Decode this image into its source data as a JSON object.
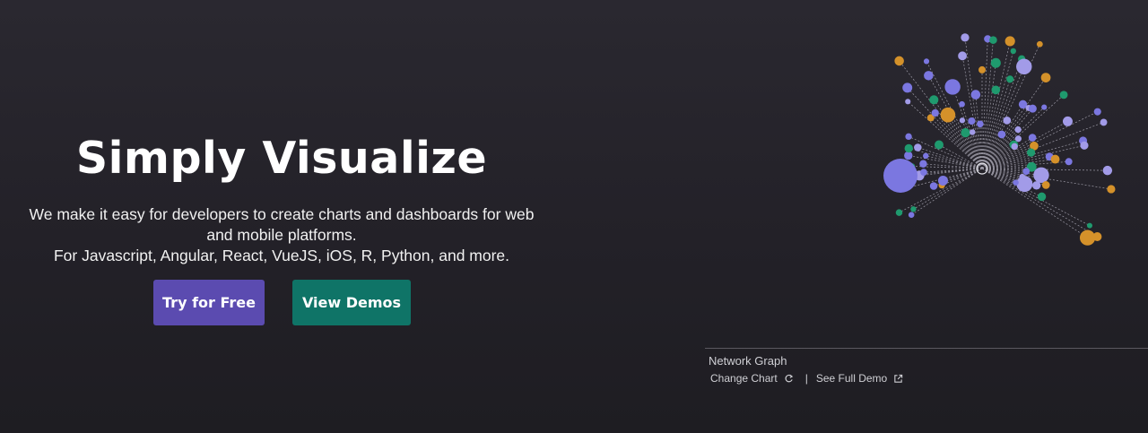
{
  "hero": {
    "headline": "Simply Visualize",
    "subtitle_lines": [
      "We make it easy for developers to create charts and dashboards for web",
      "and mobile platforms.",
      "For Javascript, Angular, React, VueJS, iOS, R, Python, and more."
    ],
    "buttons": {
      "try_label": "Try for Free",
      "demo_label": "View Demos"
    }
  },
  "chart_caption": {
    "title": "Network Graph",
    "change_chart_label": "Change Chart",
    "separator": "|",
    "full_demo_label": "See Full Demo",
    "icons": [
      "refresh-icon",
      "external-link-icon"
    ]
  },
  "colors": {
    "try_button": "#5b4bb0",
    "demo_button": "#0f7467",
    "node_palette": [
      "#7b77e0",
      "#a29be8",
      "#d4912a",
      "#1f9a6e"
    ]
  }
}
